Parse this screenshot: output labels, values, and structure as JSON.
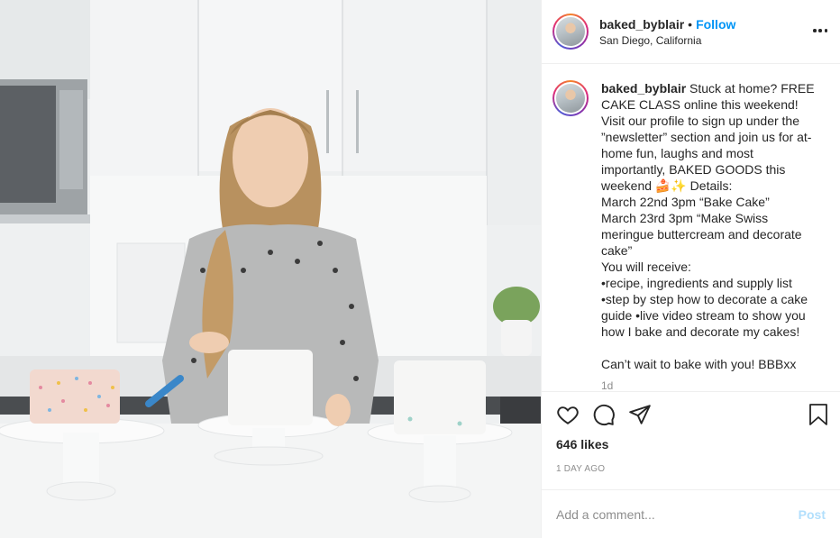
{
  "post": {
    "username": "baked_byblair",
    "separator": "•",
    "follow_label": "Follow",
    "location": "San Diego, California",
    "caption_text": " Stuck at home? FREE CAKE CLASS online this weekend! Visit our profile to sign up under the ”newsletter” section and join us for at-home fun, laughs and most importantly, BAKED GOODS this weekend 🍰✨ Details:\nMarch 22nd 3pm “Bake Cake”\nMarch 23rd 3pm “Make Swiss meringue buttercream and decorate cake”\nYou will receive:\n•recipe, ingredients and supply list\n•step by step how to decorate a cake guide •live video stream to show you how I bake and decorate my cakes!\n\nCan’t wait to bake with you! BBBxx",
    "caption_time": "1d",
    "likes": "646 likes",
    "posted_ago": "1 DAY AGO",
    "comment_placeholder": "Add a comment...",
    "post_label": "Post"
  },
  "icons": [
    "heart-icon",
    "comment-icon",
    "share-icon",
    "bookmark-icon",
    "more-options-icon"
  ],
  "colors": {
    "accent": "#0095f6",
    "text": "#262626",
    "muted": "#8e8e8e",
    "post_disabled": "#b2dffc"
  }
}
